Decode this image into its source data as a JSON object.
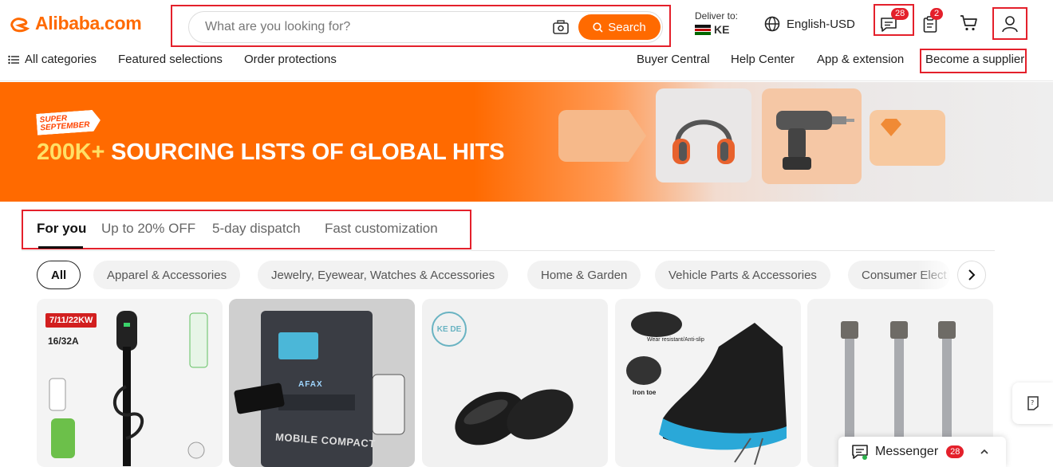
{
  "header": {
    "logo_text": "Alibaba.com",
    "search": {
      "placeholder": "What are you looking for?",
      "button_label": "Search"
    },
    "deliver": {
      "label": "Deliver to:",
      "country": "KE"
    },
    "language": "English-USD",
    "messages_badge": "28",
    "orders_badge": "2"
  },
  "nav": {
    "all_categories": "All categories",
    "featured_selections": "Featured selections",
    "order_protections": "Order protections",
    "buyer_central": "Buyer Central",
    "help_center": "Help Center",
    "app_extension": "App & extension",
    "become_supplier": "Become a supplier"
  },
  "banner": {
    "tag_line1": "SUPER",
    "tag_line2": "SEPTEMBER",
    "title_highlight": "200K+",
    "title_rest": " SOURCING LISTS OF GLOBAL HITS"
  },
  "tabs": [
    "For you",
    "Up to 20% OFF",
    "5-day dispatch",
    "Fast customization"
  ],
  "chips": [
    "All",
    "Apparel & Accessories",
    "Jewelry, Eyewear, Watches & Accessories",
    "Home & Garden",
    "Vehicle Parts & Accessories",
    "Consumer Elect"
  ],
  "cards": {
    "card1_tag": "7/11/22KW",
    "card1_sub": "16/32A",
    "card2_brand": "AFAX",
    "card2_caption": "MOBILE COMPACT",
    "card3_brand": "KE DE",
    "card4_caption1": "Wear resistant/Anti-slip",
    "card4_caption2": "Iron toe"
  },
  "messenger": {
    "label": "Messenger",
    "badge": "28"
  },
  "colors": {
    "brand": "#ff6a00",
    "highlight_box": "#e4202b"
  }
}
